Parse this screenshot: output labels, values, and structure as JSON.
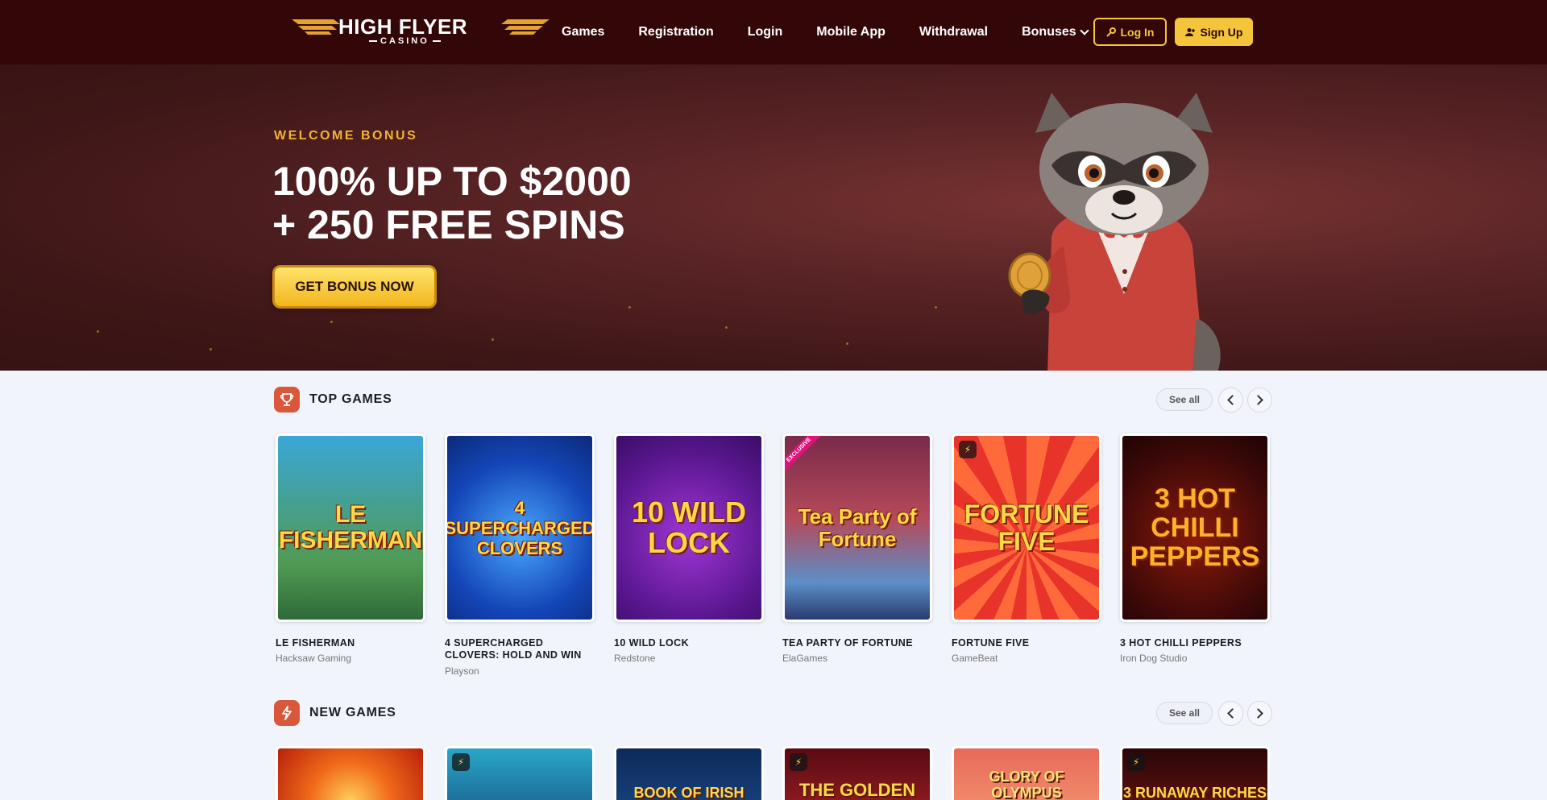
{
  "header": {
    "logo_main": "HIGH FLYER",
    "logo_sub": "CASINO",
    "nav": [
      "Games",
      "Registration",
      "Login",
      "Mobile App",
      "Withdrawal",
      "Bonuses"
    ],
    "login_label": "Log In",
    "signup_label": "Sign Up",
    "accent_color": "#f4c53a"
  },
  "hero": {
    "eyebrow": "WELCOME BONUS",
    "title_line1": "100% UP TO $2000",
    "title_line2": "+ 250 FREE SPINS",
    "cta": "GET BONUS NOW"
  },
  "top_games": {
    "title": "TOP GAMES",
    "icon": "trophy-icon",
    "see_all": "See all",
    "games": [
      {
        "name": "LE FISHERMAN",
        "provider": "Hacksaw Gaming",
        "art": "LE FISHERMAN"
      },
      {
        "name": "4 SUPERCHARGED CLOVERS: HOLD AND WIN",
        "provider": "Playson",
        "art": "4 SUPERCHARGED CLOVERS"
      },
      {
        "name": "10 WILD LOCK",
        "provider": "Redstone",
        "art": "10 WILD LOCK"
      },
      {
        "name": "TEA PARTY OF FORTUNE",
        "provider": "ElaGames",
        "art": "Tea Party of Fortune",
        "badge": "EXCLUSIVE"
      },
      {
        "name": "FORTUNE FIVE",
        "provider": "GameBeat",
        "art": "FORTUNE FIVE"
      },
      {
        "name": "3 HOT CHILLI PEPPERS",
        "provider": "Iron Dog Studio",
        "art": "3 HOT CHILLI PEPPERS"
      }
    ]
  },
  "new_games": {
    "title": "NEW GAMES",
    "icon": "bolt-icon",
    "see_all": "See all",
    "games": [
      {
        "art": ""
      },
      {
        "art": ""
      },
      {
        "art": "BOOK OF IRISH"
      },
      {
        "art": "THE GOLDEN"
      },
      {
        "art": "GLORY OF OLYMPUS"
      },
      {
        "art": "3 RUNAWAY RICHES"
      }
    ]
  }
}
